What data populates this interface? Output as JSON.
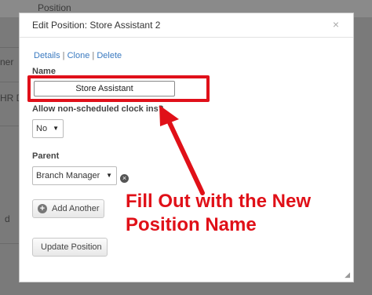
{
  "background": {
    "top_label": "Position",
    "left_fragment_1": "ner",
    "left_fragment_2": "HR D",
    "left_fragment_3": "d"
  },
  "modal": {
    "title": "Edit Position: Store Assistant 2",
    "close_glyph": "×",
    "links": {
      "details": "Details",
      "clone": "Clone",
      "delete": "Delete",
      "separator": " | "
    },
    "name_label": "Name",
    "name_value": "Store Assistant",
    "clock_label": "Allow non-scheduled clock ins?",
    "clock_value": "No",
    "parent_label": "Parent",
    "parent_value": "Branch Manager",
    "add_another_label": "Add Another",
    "update_label": "Update Position"
  },
  "annotation": {
    "line1": "Fill Out with the New",
    "line2": "Position Name",
    "color": "#e01018"
  },
  "icons": {
    "close": "close-icon",
    "caret": "caret-down-icon",
    "clear": "clear-icon",
    "plus": "plus-icon",
    "resize": "resize-handle-icon"
  }
}
